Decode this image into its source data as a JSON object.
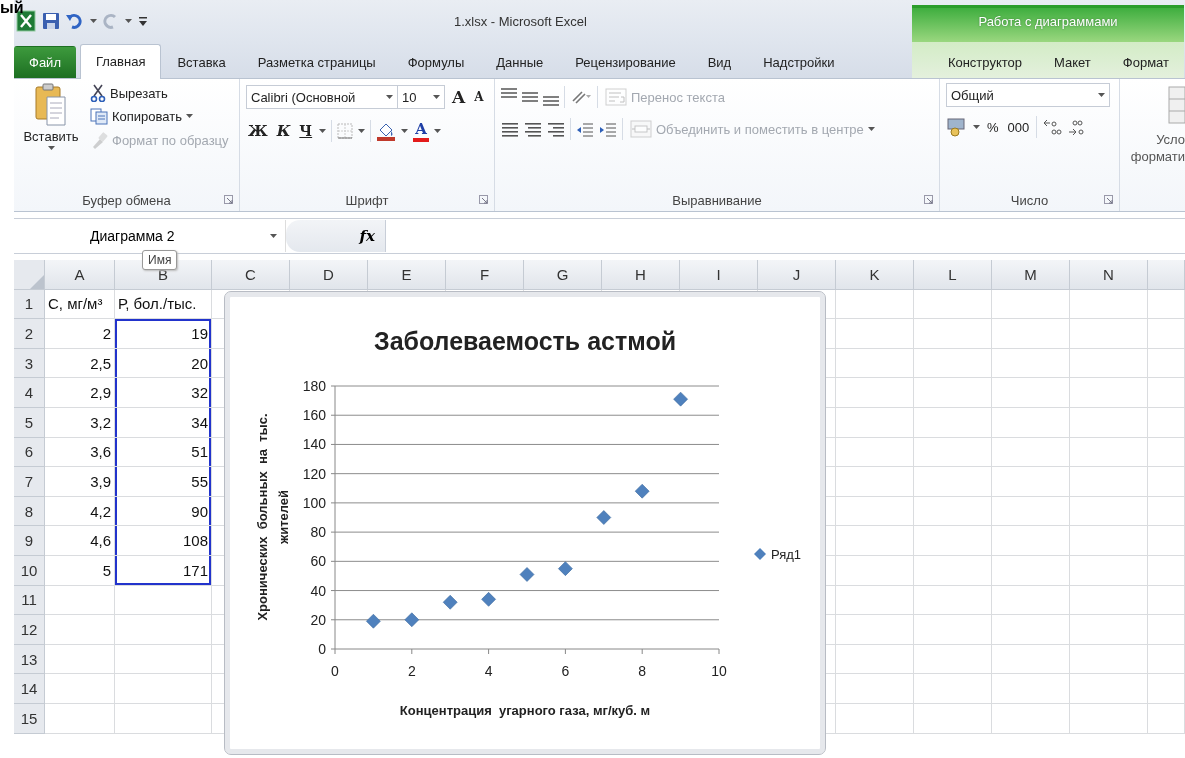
{
  "corner_text": "ый",
  "window": {
    "title": "1.xlsx - Microsoft Excel",
    "context_group": "Работа с диаграммами"
  },
  "tabs": [
    {
      "label": "Файл",
      "kind": "file",
      "selected": false
    },
    {
      "label": "Главная",
      "kind": "tab",
      "selected": true
    },
    {
      "label": "Вставка",
      "kind": "tab",
      "selected": false
    },
    {
      "label": "Разметка страницы",
      "kind": "tab",
      "selected": false
    },
    {
      "label": "Формулы",
      "kind": "tab",
      "selected": false
    },
    {
      "label": "Данные",
      "kind": "tab",
      "selected": false
    },
    {
      "label": "Рецензирование",
      "kind": "tab",
      "selected": false
    },
    {
      "label": "Вид",
      "kind": "tab",
      "selected": false
    },
    {
      "label": "Надстройки",
      "kind": "tab",
      "selected": false
    },
    {
      "label": "Конструктор",
      "kind": "context",
      "selected": false
    },
    {
      "label": "Макет",
      "kind": "context",
      "selected": false
    },
    {
      "label": "Формат",
      "kind": "context",
      "selected": false
    }
  ],
  "ribbon": {
    "clipboard": {
      "label": "Буфер обмена",
      "paste": "Вставить",
      "cut": {
        "label": "Вырезать",
        "disabled": false
      },
      "copy": {
        "label": "Копировать",
        "disabled": false
      },
      "format_painter": {
        "label": "Формат по образцу",
        "disabled": true
      }
    },
    "font": {
      "label": "Шрифт",
      "name": "Calibri (Основной",
      "size": "10",
      "grow": "A",
      "shrink": "A",
      "bold": "Ж",
      "italic": "К",
      "underline": "Ч",
      "font_color_label": "A"
    },
    "alignment": {
      "label": "Выравнивание",
      "wrap": {
        "label": "Перенос текста",
        "disabled": true
      },
      "merge": {
        "label": "Объединить и поместить в центре",
        "disabled": true
      }
    },
    "number": {
      "label": "Число",
      "format": "Общий",
      "percent": "%",
      "thousands": "000"
    },
    "styles": {
      "line_1": "Усло",
      "line_2": "формати"
    }
  },
  "formula_bar": {
    "name_box": "Диаграмма 2",
    "fx": "fx",
    "tooltip": "Имя"
  },
  "columns": [
    "A",
    "B",
    "C",
    "D",
    "E",
    "F",
    "G",
    "H",
    "I",
    "J",
    "K",
    "L",
    "M",
    "N"
  ],
  "rows": [
    {
      "number": "1",
      "cells": [
        {
          "text": "С, мг/м³",
          "selected": false
        },
        {
          "text": "Р, бол./тыс.",
          "selected": false
        }
      ]
    },
    {
      "number": "2",
      "cells": [
        {
          "text": "2",
          "selected": false
        },
        {
          "text": "19",
          "selected": true
        }
      ]
    },
    {
      "number": "3",
      "cells": [
        {
          "text": "2,5",
          "selected": false
        },
        {
          "text": "20",
          "selected": true
        }
      ]
    },
    {
      "number": "4",
      "cells": [
        {
          "text": "2,9",
          "selected": false
        },
        {
          "text": "32",
          "selected": true
        }
      ]
    },
    {
      "number": "5",
      "cells": [
        {
          "text": "3,2",
          "selected": false
        },
        {
          "text": "34",
          "selected": true
        }
      ]
    },
    {
      "number": "6",
      "cells": [
        {
          "text": "3,6",
          "selected": false
        },
        {
          "text": "51",
          "selected": true
        }
      ]
    },
    {
      "number": "7",
      "cells": [
        {
          "text": "3,9",
          "selected": false
        },
        {
          "text": "55",
          "selected": true
        }
      ]
    },
    {
      "number": "8",
      "cells": [
        {
          "text": "4,2",
          "selected": false
        },
        {
          "text": "90",
          "selected": true
        }
      ]
    },
    {
      "number": "9",
      "cells": [
        {
          "text": "4,6",
          "selected": false
        },
        {
          "text": "108",
          "selected": true
        }
      ]
    },
    {
      "number": "10",
      "cells": [
        {
          "text": "5",
          "selected": false
        },
        {
          "text": "171",
          "selected": true
        }
      ]
    },
    {
      "number": "11",
      "cells": []
    },
    {
      "number": "12",
      "cells": []
    },
    {
      "number": "13",
      "cells": []
    },
    {
      "number": "14",
      "cells": []
    },
    {
      "number": "15",
      "cells": []
    }
  ],
  "chart": {
    "chart_data": {
      "type": "scatter",
      "title": "Заболеваемость астмой",
      "xlabel": "Концентрация  угарного газа, мг/куб. м",
      "ylabel": "Хронических  больных  на  тыс. жителей",
      "x": [
        1,
        2,
        3,
        4,
        5,
        6,
        7,
        8,
        9
      ],
      "series": [
        {
          "name": "Ряд1",
          "color": "#4f81bd",
          "values": [
            19,
            20,
            32,
            34,
            51,
            55,
            90,
            108,
            171
          ]
        }
      ],
      "grid": true,
      "xlim": [
        0,
        10
      ],
      "ylim": [
        0,
        180
      ],
      "xticks": [
        0,
        2,
        4,
        6,
        8,
        10
      ],
      "yticks": [
        0,
        20,
        40,
        60,
        80,
        100,
        120,
        140,
        160,
        180
      ]
    }
  }
}
